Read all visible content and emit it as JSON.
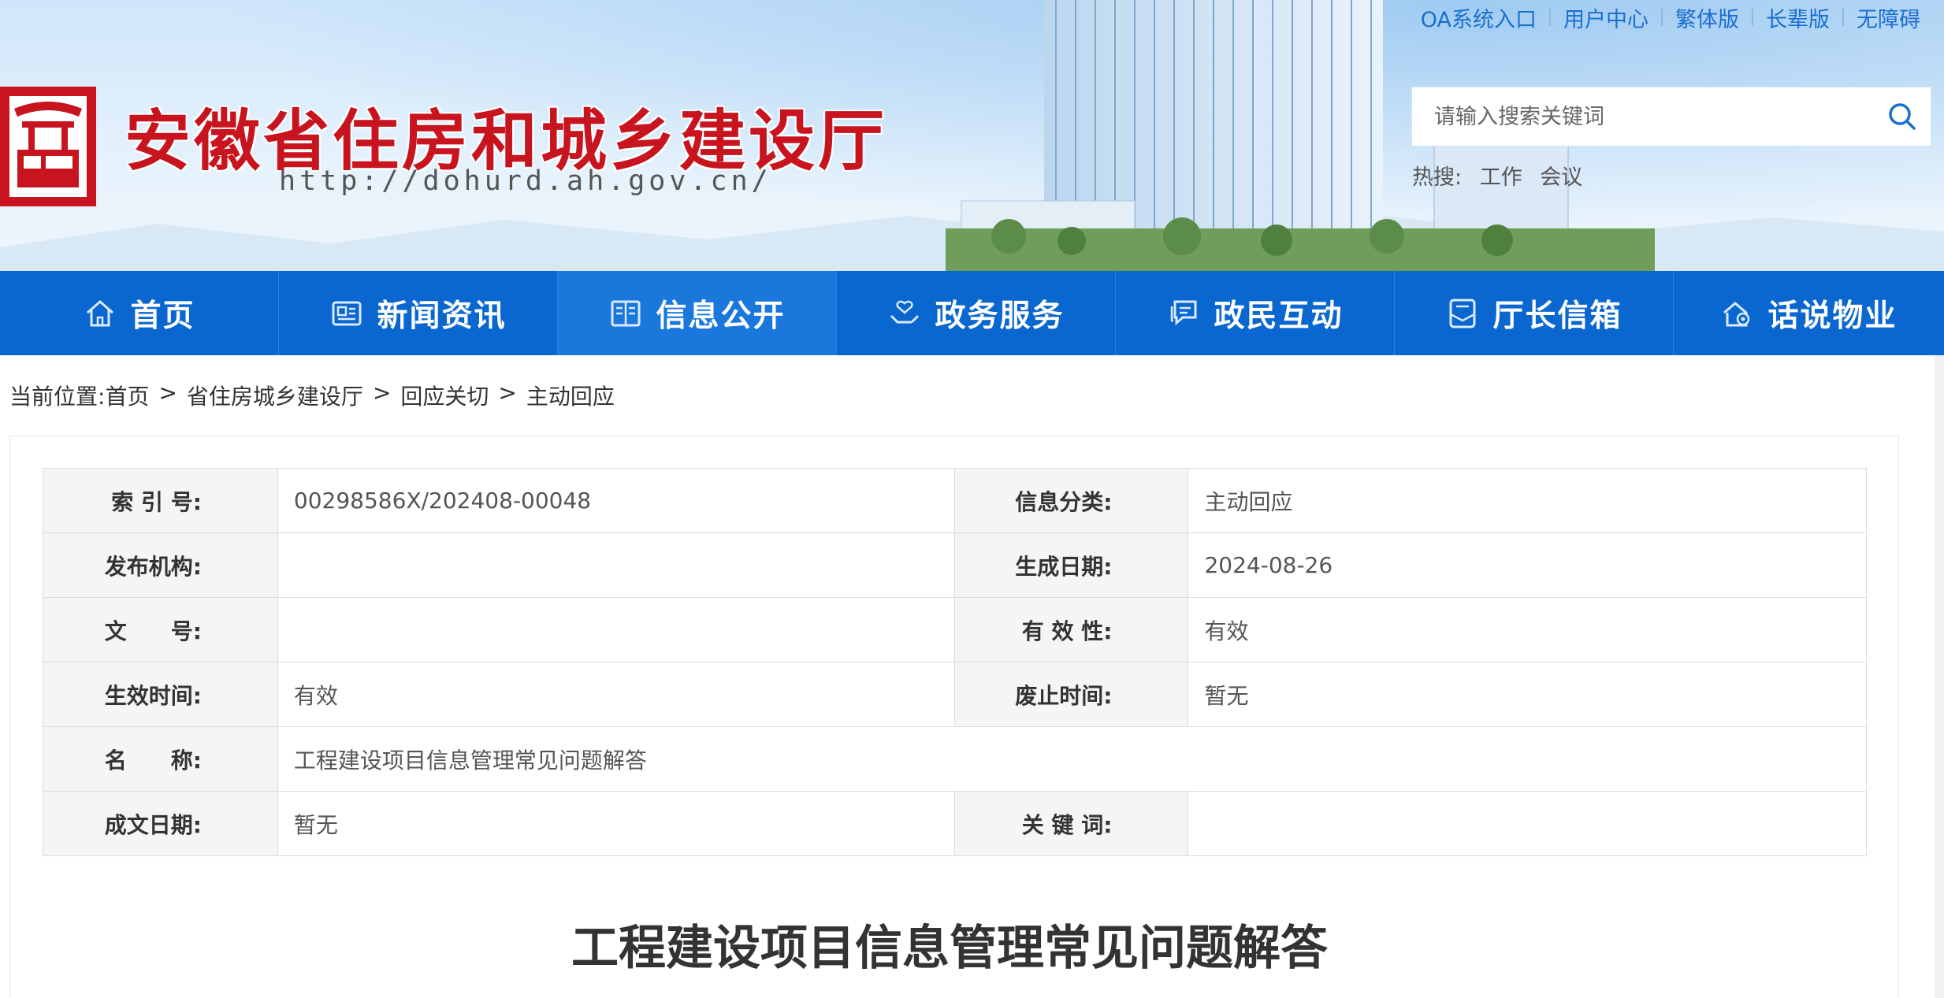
{
  "header": {
    "site_title": "安徽省住房和城乡建设厅",
    "site_url": "http://dohurd.ah.gov.cn/",
    "top_links": [
      "OA系统入口",
      "用户中心",
      "繁体版",
      "长辈版",
      "无障碍"
    ],
    "search_placeholder": "请输入搜索关键词",
    "hot_label": "热搜:",
    "hot_terms": [
      "工作",
      "会议"
    ]
  },
  "nav": {
    "items": [
      {
        "label": "首页",
        "icon": "home-icon"
      },
      {
        "label": "新闻资讯",
        "icon": "news-icon"
      },
      {
        "label": "信息公开",
        "icon": "book-icon"
      },
      {
        "label": "政务服务",
        "icon": "service-hand-icon"
      },
      {
        "label": "政民互动",
        "icon": "chat-icon"
      },
      {
        "label": "厅长信箱",
        "icon": "mailbox-icon"
      },
      {
        "label": "话说物业",
        "icon": "house-gear-icon"
      }
    ],
    "active_index": 2
  },
  "breadcrumb": {
    "label": "当前位置:",
    "items": [
      "首页",
      "省住房城乡建设厅",
      "回应关切",
      "主动回应"
    ],
    "separator": ">"
  },
  "info_table": {
    "index_label": "索 引 号:",
    "index_value": "00298586X/202408-00048",
    "category_label": "信息分类:",
    "category_value": "主动回应",
    "publisher_label": "发布机构:",
    "publisher_value": "",
    "gen_date_label": "生成日期:",
    "gen_date_value": "2024-08-26",
    "doc_no_label": "文　　号:",
    "doc_no_value": "",
    "validity_label": "有 效 性:",
    "validity_value": "有效",
    "effective_label": "生效时间:",
    "effective_value": "有效",
    "abolish_label": "废止时间:",
    "abolish_value": "暂无",
    "name_label": "名　　称:",
    "name_value": "工程建设项目信息管理常见问题解答",
    "written_date_label": "成文日期:",
    "written_date_value": "暂无",
    "keywords_label": "关 键 词:",
    "keywords_value": ""
  },
  "article": {
    "title": "工程建设项目信息管理常见问题解答"
  },
  "colors": {
    "nav_bg": "#0a67cf",
    "title_red": "#c8141e",
    "link_blue": "#1a6fcf"
  }
}
